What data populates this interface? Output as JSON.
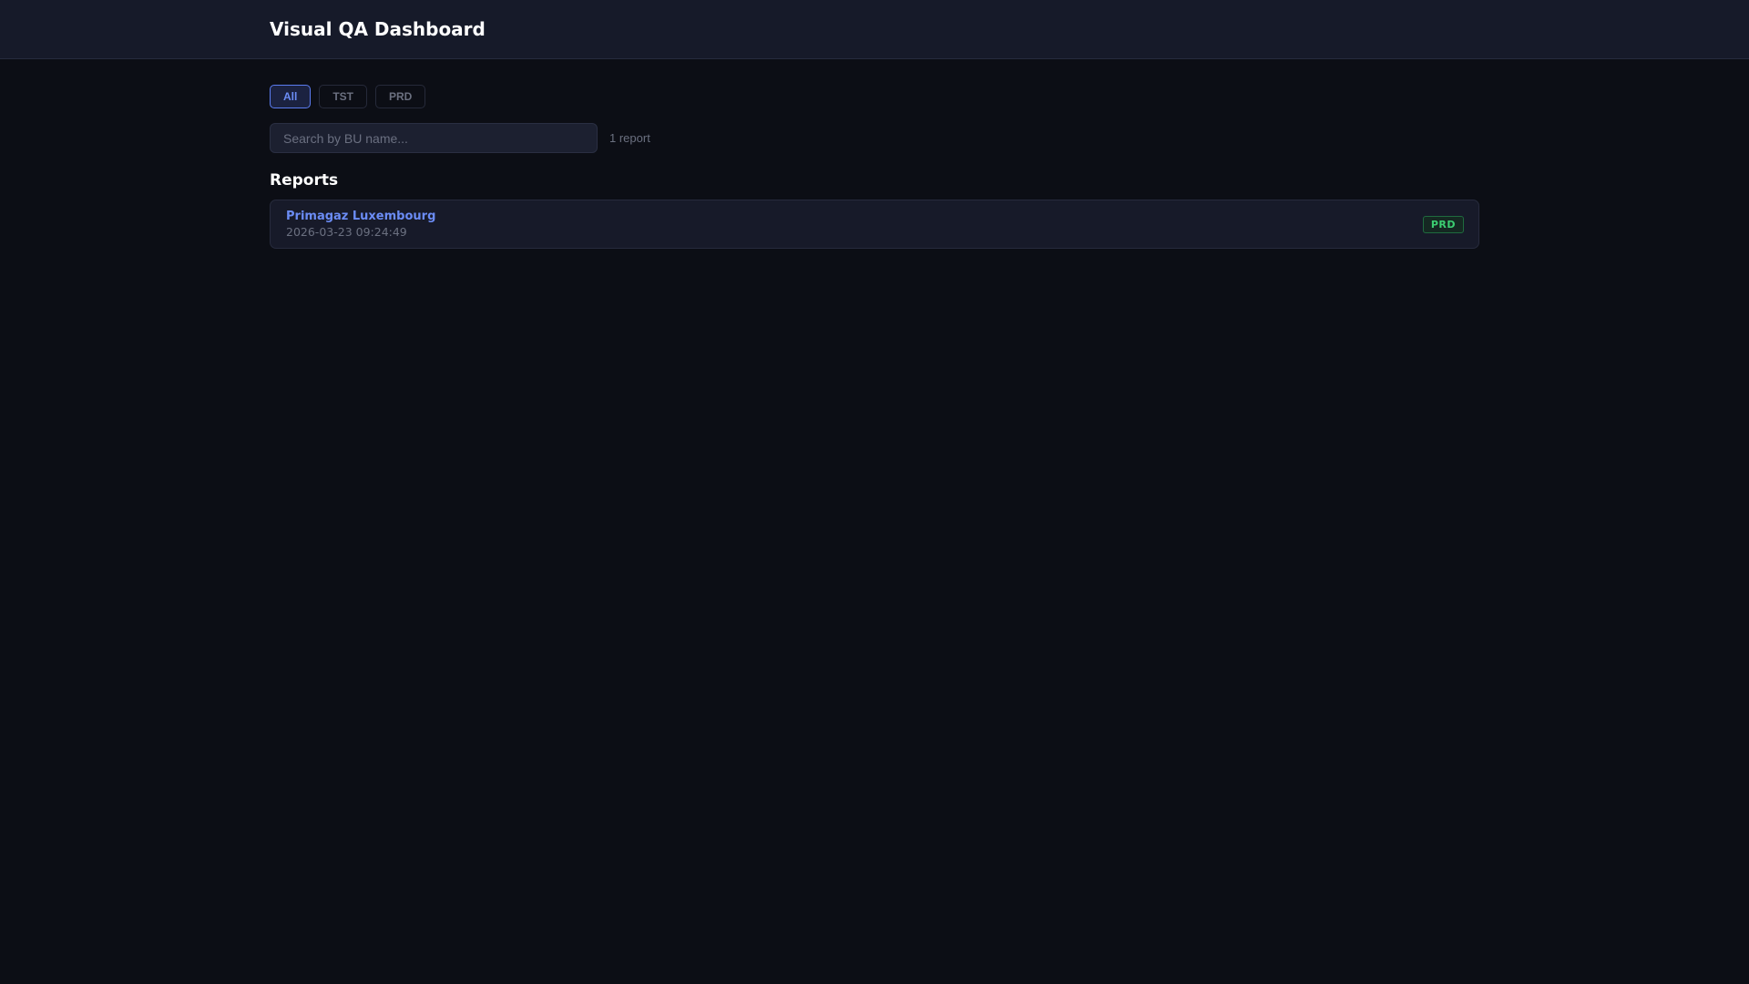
{
  "header": {
    "title": "Visual QA Dashboard"
  },
  "filters": [
    {
      "label": "All",
      "active": true
    },
    {
      "label": "TST",
      "active": false
    },
    {
      "label": "PRD",
      "active": false
    }
  ],
  "search": {
    "placeholder": "Search by BU name...",
    "value": ""
  },
  "count": "1 report",
  "reports_heading": "Reports",
  "reports": [
    {
      "name": "Primagaz Luxembourg",
      "timestamp": "2026-03-23 09:24:49",
      "env": "PRD"
    }
  ]
}
